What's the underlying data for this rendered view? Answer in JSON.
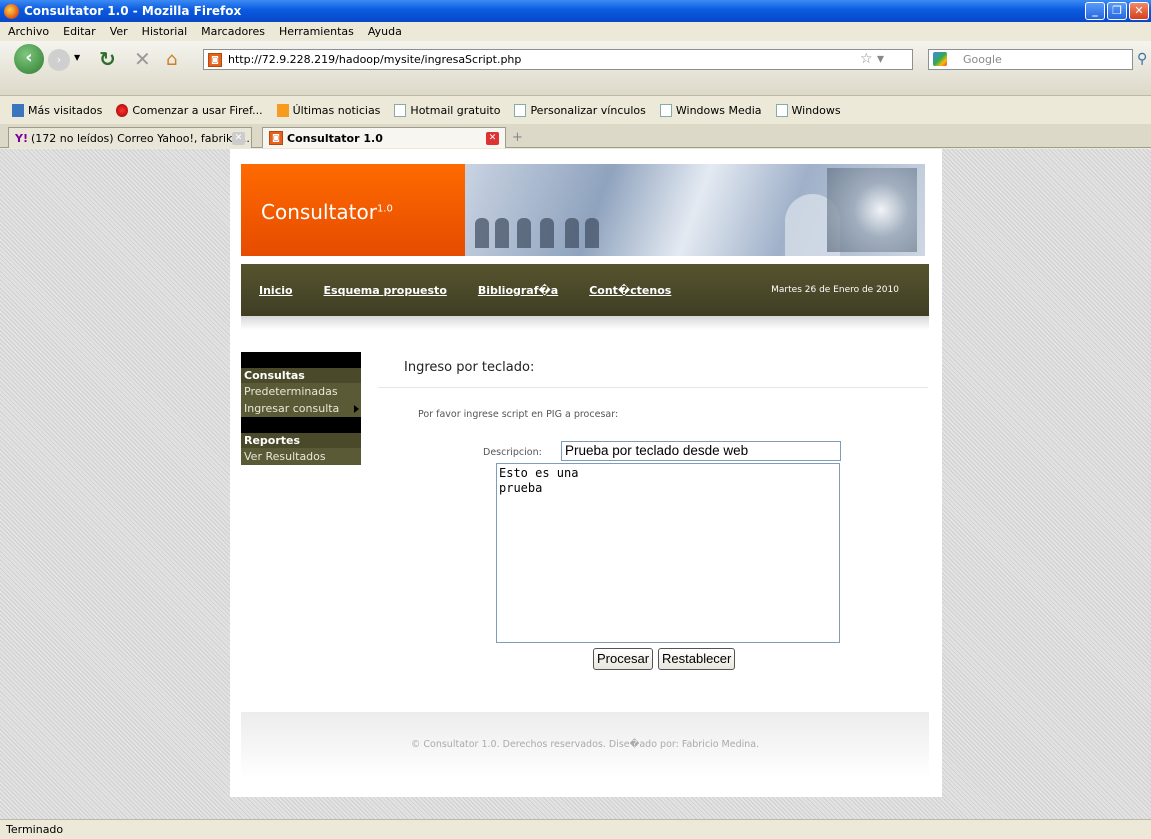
{
  "window": {
    "title": "Consultator 1.0 - Mozilla Firefox",
    "buttons": [
      "_",
      "❐",
      "✕"
    ]
  },
  "menu": [
    "Archivo",
    "Editar",
    "Ver",
    "Historial",
    "Marcadores",
    "Herramientas",
    "Ayuda"
  ],
  "nav": {
    "url": "http://72.9.228.219/hadoop/mysite/ingresaScript.php",
    "search_placeholder": "Google"
  },
  "bookmarks": [
    "Más visitados",
    "Comenzar a usar Firef...",
    "Últimas noticias",
    "Hotmail gratuito",
    "Personalizar vínculos",
    "Windows Media",
    "Windows"
  ],
  "tabs": [
    {
      "label": "(172 no leídos) Correo Yahoo!, fabrik9..."
    },
    {
      "label": "Consultator 1.0"
    }
  ],
  "site": {
    "brand": "Consultator",
    "brand_version": "1.0",
    "nav_links": [
      "Inicio",
      "Esquema propuesto",
      "Bibliograf�a",
      "Cont�ctenos"
    ],
    "date": "Martes 26 de Enero de 2010",
    "sidebar": {
      "consultas_heading": "Consultas",
      "consultas_items": [
        "Predeterminadas",
        "Ingresar consulta"
      ],
      "reportes_heading": "Reportes",
      "reportes_items": [
        "Ver Resultados"
      ]
    },
    "content_title": "Ingreso por teclado:",
    "instructions": "Por favor ingrese script en PIG a procesar:",
    "description_label": "Descripcion:",
    "description_value": "Prueba por teclado desde web",
    "script_value": "Esto es una\nprueba",
    "buttons": {
      "submit": "Procesar",
      "reset": "Restablecer"
    },
    "footer": "© Consultator 1.0. Derechos reservados. Dise�ado por: Fabricio Medina."
  },
  "status": "Terminado"
}
